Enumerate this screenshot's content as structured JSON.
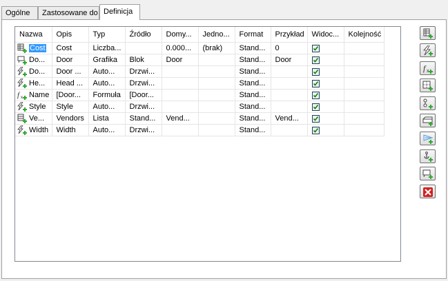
{
  "tabs": [
    {
      "label": "Ogólne"
    },
    {
      "label": "Zastosowane do"
    },
    {
      "label": "Definicja"
    }
  ],
  "table": {
    "columns": [
      "Nazwa",
      "Opis",
      "Typ",
      "Źródło",
      "Domy...",
      "Jedno...",
      "Format",
      "Przykład",
      "Widoc...",
      "Kolejność"
    ],
    "rows": [
      {
        "icon": "table-property-icon",
        "name": "Cost",
        "desc": "Cost",
        "type": "Liczba...",
        "source": "",
        "default": "0.000...",
        "unit": "(brak)",
        "format": "Stand...",
        "example": "0",
        "visible": true,
        "order": ""
      },
      {
        "icon": "graphic-property-icon",
        "name": "Do...",
        "desc": "Door",
        "type": "Grafika",
        "source": "Blok",
        "default": "Door",
        "unit": "",
        "format": "Stand...",
        "example": "Door",
        "visible": true,
        "order": ""
      },
      {
        "icon": "automatic-property-icon",
        "name": "Do...",
        "desc": "Door ...",
        "type": "Auto...",
        "source": "Drzwi...",
        "default": "",
        "unit": "",
        "format": "Stand...",
        "example": "",
        "visible": true,
        "order": ""
      },
      {
        "icon": "automatic-property-icon",
        "name": "He...",
        "desc": "Head ...",
        "type": "Auto...",
        "source": "Drzwi...",
        "default": "",
        "unit": "",
        "format": "Stand...",
        "example": "",
        "visible": true,
        "order": ""
      },
      {
        "icon": "formula-property-icon",
        "name": "Name",
        "desc": "[Door...",
        "type": "Formuła",
        "source": "[Door...",
        "default": "",
        "unit": "",
        "format": "Stand...",
        "example": "",
        "visible": true,
        "order": ""
      },
      {
        "icon": "automatic-property-icon",
        "name": "Style",
        "desc": "Style",
        "type": "Auto...",
        "source": "Drzwi...",
        "default": "",
        "unit": "",
        "format": "Stand...",
        "example": "",
        "visible": true,
        "order": ""
      },
      {
        "icon": "list-property-icon",
        "name": "Ve...",
        "desc": "Vendors",
        "type": "Lista",
        "source": "Stand...",
        "default": "Vend...",
        "unit": "",
        "format": "Stand...",
        "example": "Vend...",
        "visible": true,
        "order": ""
      },
      {
        "icon": "automatic-property-icon",
        "name": "Width",
        "desc": "Width",
        "type": "Auto...",
        "source": "Drzwi...",
        "default": "",
        "unit": "",
        "format": "Stand...",
        "example": "",
        "visible": true,
        "order": ""
      }
    ]
  },
  "toolbar": [
    "add-manual-property-icon",
    "add-automatic-property-icon",
    "add-formula-property-icon",
    "add-location-property-icon",
    "add-classification-property-icon",
    "add-material-property-icon",
    "add-property-set-icon",
    "add-anchor-property-icon",
    "add-graphic-property-icon",
    "delete-icon"
  ],
  "colors": {
    "selection": "#3399ff",
    "green_plus": "#2fa82f",
    "delete_red": "#d42020"
  }
}
